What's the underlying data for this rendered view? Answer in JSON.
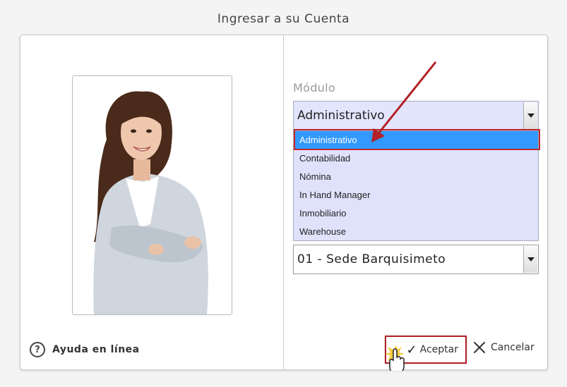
{
  "dialog": {
    "title": "Ingresar a su Cuenta"
  },
  "help": {
    "label": "Ayuda en línea",
    "icon_char": "?"
  },
  "module": {
    "label": "Módulo",
    "selected": "Administrativo",
    "options": [
      "Administrativo",
      "Contabilidad",
      "Nómina",
      "In Hand Manager",
      "Inmobiliario",
      "Warehouse"
    ]
  },
  "sede": {
    "selected": "01 - Sede Barquisimeto"
  },
  "actions": {
    "accept_label": "Aceptar",
    "cancel_label": "Cancelar"
  },
  "colors": {
    "select_bg": "#e3e5fd",
    "option_highlight": "#3399ff",
    "annotation_red": "#c0282e"
  },
  "icons": {
    "help": "help-circle-icon",
    "check": "check-icon",
    "close": "close-icon",
    "cursor": "hand-cursor-icon",
    "user": "user-photo"
  }
}
